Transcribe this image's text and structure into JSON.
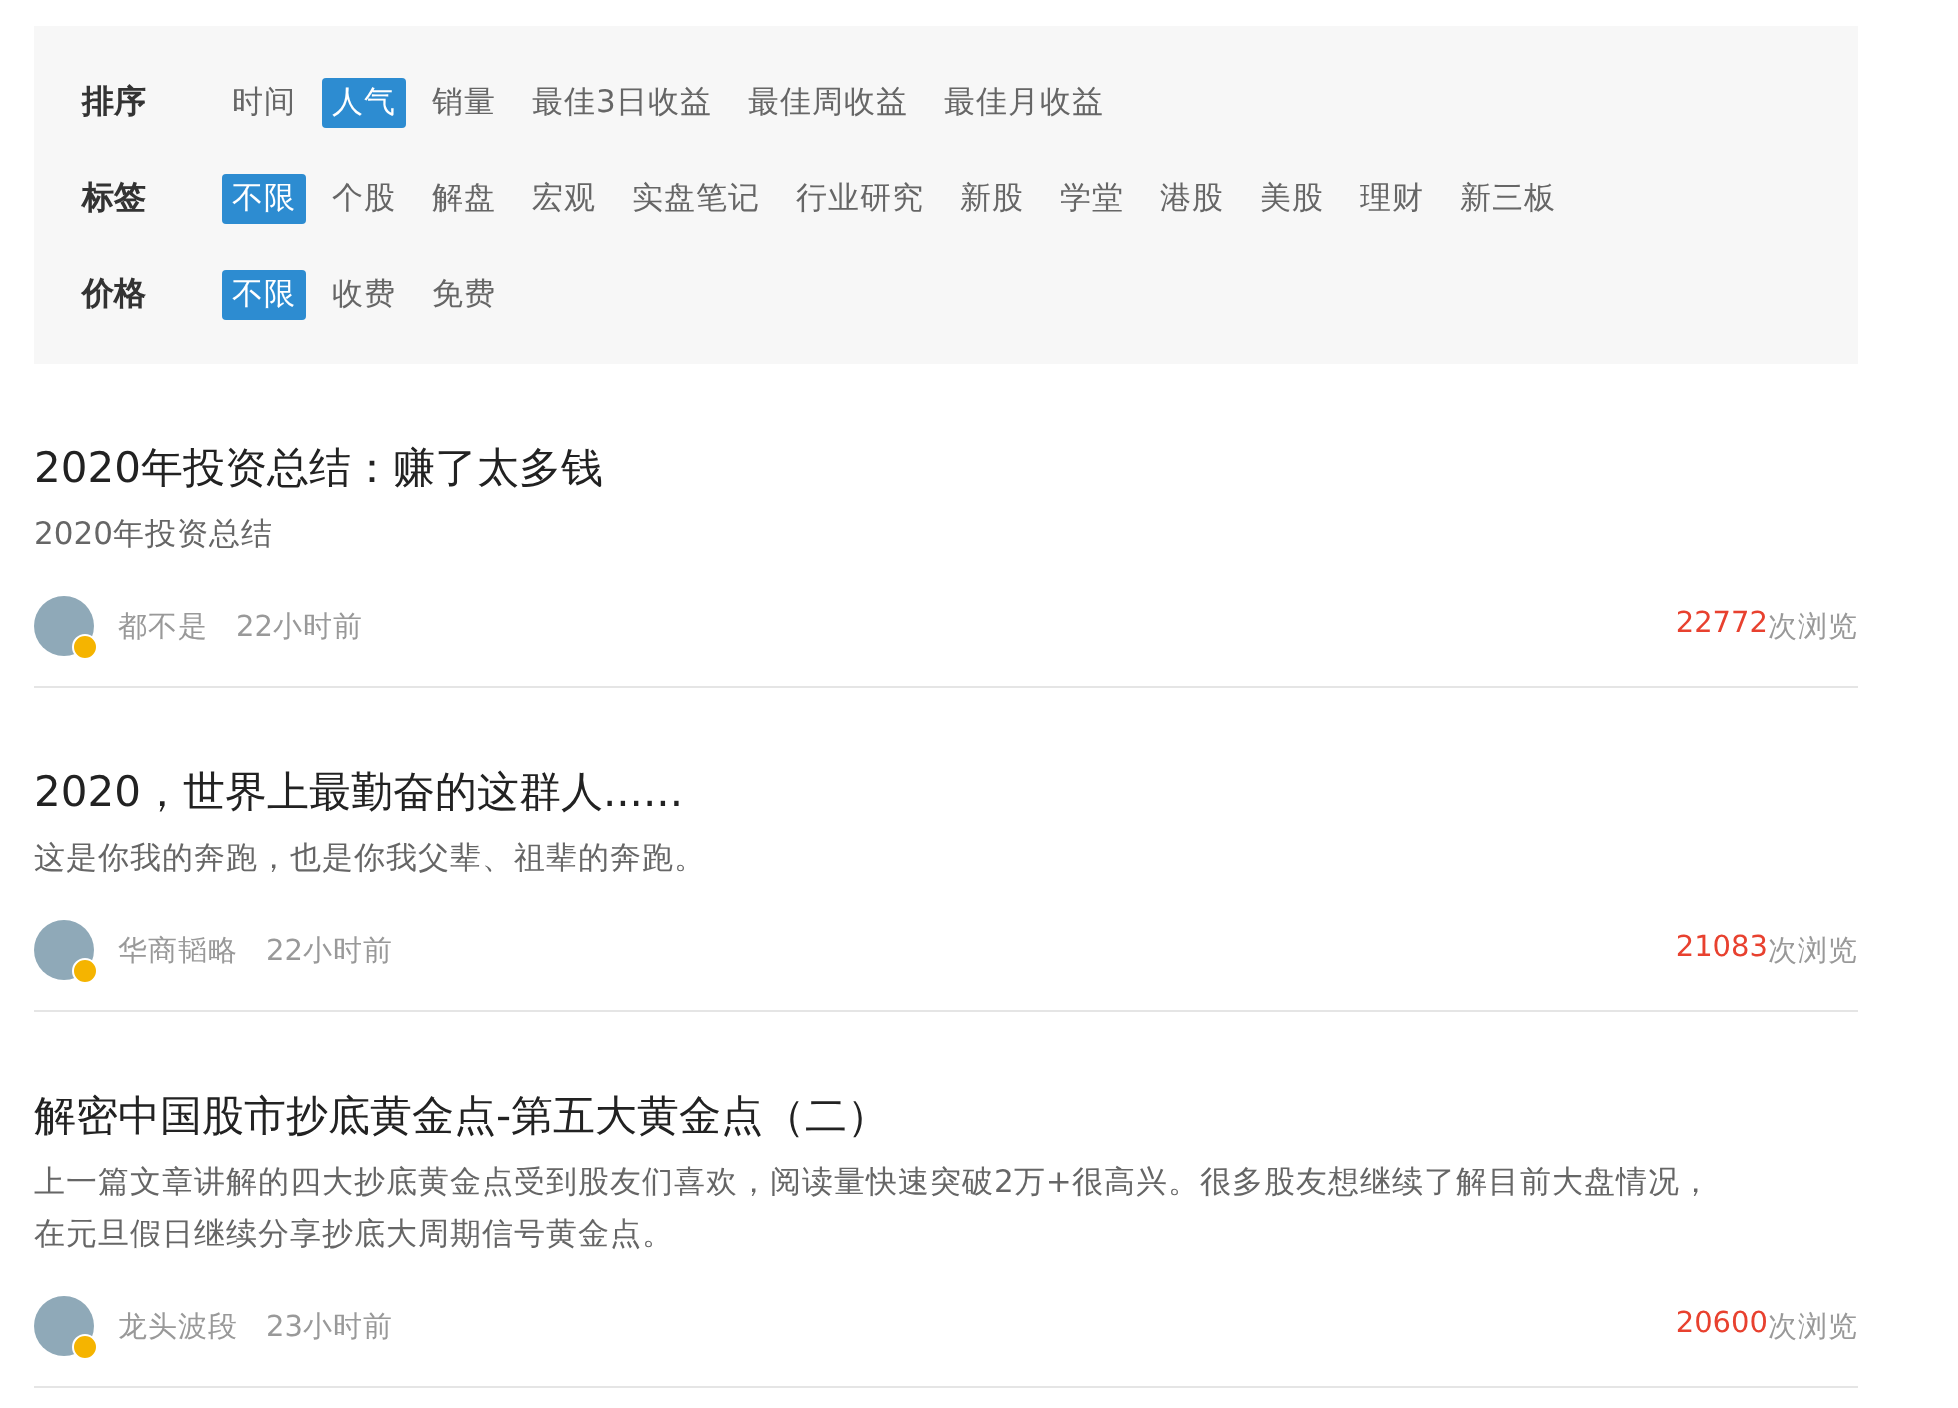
{
  "filters": [
    {
      "label": "排序",
      "options": [
        {
          "text": "时间",
          "selected": false
        },
        {
          "text": "人气",
          "selected": true
        },
        {
          "text": "销量",
          "selected": false
        },
        {
          "text": "最佳3日收益",
          "selected": false
        },
        {
          "text": "最佳周收益",
          "selected": false
        },
        {
          "text": "最佳月收益",
          "selected": false
        }
      ]
    },
    {
      "label": "标签",
      "options": [
        {
          "text": "不限",
          "selected": true
        },
        {
          "text": "个股",
          "selected": false
        },
        {
          "text": "解盘",
          "selected": false
        },
        {
          "text": "宏观",
          "selected": false
        },
        {
          "text": "实盘笔记",
          "selected": false
        },
        {
          "text": "行业研究",
          "selected": false
        },
        {
          "text": "新股",
          "selected": false
        },
        {
          "text": "学堂",
          "selected": false
        },
        {
          "text": "港股",
          "selected": false
        },
        {
          "text": "美股",
          "selected": false
        },
        {
          "text": "理财",
          "selected": false
        },
        {
          "text": "新三板",
          "selected": false
        }
      ]
    },
    {
      "label": "价格",
      "options": [
        {
          "text": "不限",
          "selected": true
        },
        {
          "text": "收费",
          "selected": false
        },
        {
          "text": "免费",
          "selected": false
        }
      ]
    }
  ],
  "articles": [
    {
      "title": "2020年投资总结：赚了太多钱",
      "summary": "2020年投资总结",
      "author": "都不是",
      "time": "22小时前",
      "views": "22772",
      "views_label": "次浏览",
      "verified": true
    },
    {
      "title": "2020，世界上最勤奋的这群人......",
      "summary": "这是你我的奔跑，也是你我父辈、祖辈的奔跑。",
      "author": "华商韬略",
      "time": "22小时前",
      "views": "21083",
      "views_label": "次浏览",
      "verified": true
    },
    {
      "title": "解密中国股市抄底黄金点-第五大黄金点（二）",
      "summary": "上一篇文章讲解的四大抄底黄金点受到股友们喜欢，阅读量快速突破2万+很高兴。很多股友想继续了解目前大盘情况，在元旦假日继续分享抄底大周期信号黄金点。",
      "author": "龙头波段",
      "time": "23小时前",
      "views": "20600",
      "views_label": "次浏览",
      "verified": true
    }
  ]
}
